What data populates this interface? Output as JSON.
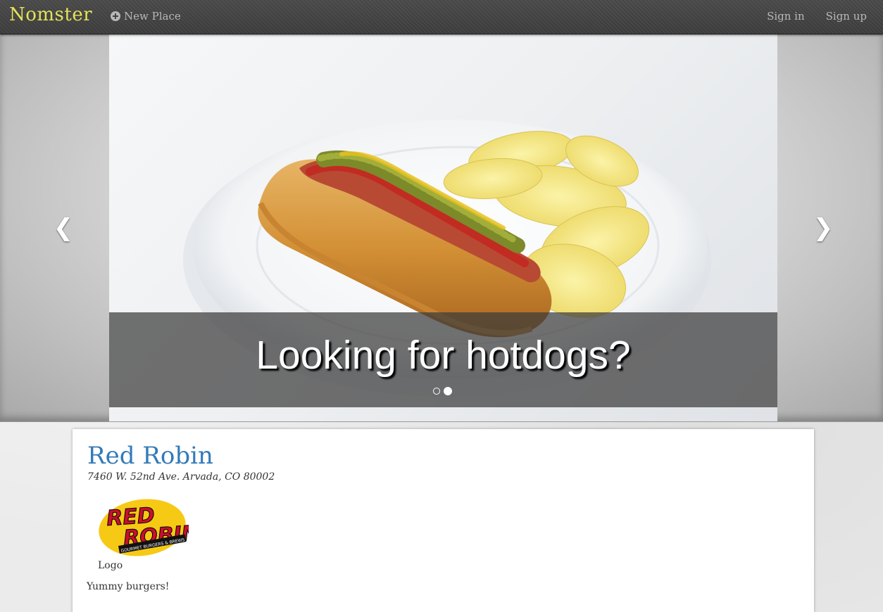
{
  "navbar": {
    "brand": "Nomster",
    "new_place_label": "New Place",
    "sign_in_label": "Sign in",
    "sign_up_label": "Sign up"
  },
  "carousel": {
    "caption": "Looking for hotdogs?",
    "slide_count": 2,
    "active_index": 1,
    "prev_icon": "chevron-left-icon",
    "next_icon": "chevron-right-icon"
  },
  "place": {
    "name": "Red Robin",
    "address": "7460 W. 52nd Ave. Arvada, CO 80002",
    "logo_caption": "Logo",
    "logo_text_line1": "RED",
    "logo_text_line2": "ROBIN",
    "logo_tagline": "GOURMET BURGERS & BREWS",
    "description": "Yummy burgers!"
  },
  "colors": {
    "brand": "#e3e35a",
    "place_name": "#337ab7",
    "logo_red": "#c8102e",
    "logo_yellow": "#f6c915"
  }
}
